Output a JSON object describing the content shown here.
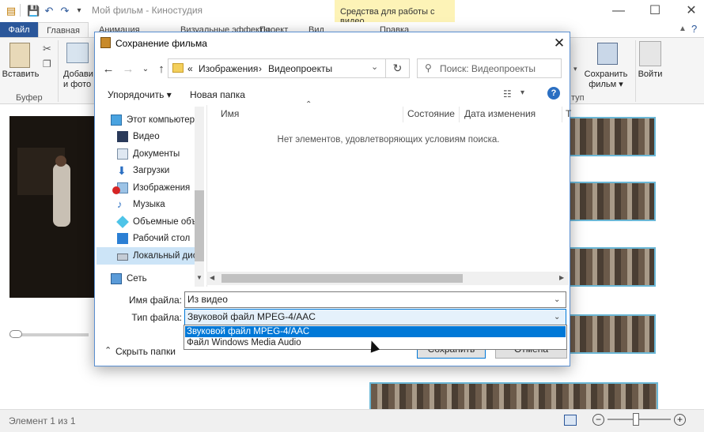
{
  "window": {
    "title": "Мой фильм - Киностудия",
    "tools_tab": "Средства для работы с видео",
    "tools_subtab": "Правка"
  },
  "tabs": [
    "Файл",
    "Главная",
    "Анимация",
    "Визуальные эффекты",
    "Проект",
    "Вид"
  ],
  "ribbon": {
    "paste": "Вставить",
    "buffer_group": "Буфер",
    "add_video_line1": "Добави",
    "add_video_line2": "и фото",
    "save_movie_line1": "Сохранить",
    "save_movie_line2": "фильм ▾",
    "signin": "Войти",
    "access_group": "туп"
  },
  "dialog": {
    "title": "Сохранение фильма",
    "breadcrumb": {
      "prefix": "«",
      "part1": "Изображения",
      "sep": "›",
      "part2": "Видеопроекты"
    },
    "search_placeholder": "Поиск: Видеопроекты",
    "organize": "Упорядочить ▾",
    "new_folder": "Новая папка",
    "nav_items": [
      {
        "label": "Этот компьютер",
        "icon": "computer-icon"
      },
      {
        "label": "Видео",
        "icon": "video-folder-icon"
      },
      {
        "label": "Документы",
        "icon": "documents-folder-icon"
      },
      {
        "label": "Загрузки",
        "icon": "downloads-folder-icon"
      },
      {
        "label": "Изображения",
        "icon": "pictures-folder-icon"
      },
      {
        "label": "Музыка",
        "icon": "music-folder-icon"
      },
      {
        "label": "Объемные объ",
        "icon": "3d-objects-folder-icon"
      },
      {
        "label": "Рабочий стол",
        "icon": "desktop-folder-icon"
      },
      {
        "label": "Локальный дис",
        "icon": "local-disk-icon"
      },
      {
        "label": "Сеть",
        "icon": "network-icon"
      }
    ],
    "columns": [
      "Имя",
      "Состояние",
      "Дата изменения",
      "Т"
    ],
    "empty_message": "Нет элементов, удовлетворяющих условиям поиска.",
    "filename_label": "Имя файла:",
    "filename_value": "Из видео",
    "filetype_label": "Тип файла:",
    "filetype_value": "Звуковой файл MPEG-4/AAC",
    "filetype_options": [
      "Звуковой файл MPEG-4/AAC",
      "Файл Windows Media Audio"
    ],
    "hide_folders": "Скрыть папки",
    "save_button": "Сохранить",
    "cancel_button": "Отмена"
  },
  "status": {
    "text": "Элемент 1 из 1"
  },
  "colors": {
    "file_tab": "#2b579a",
    "tools_tab": "#fdf3b7",
    "selected_option": "#0078d7",
    "storyboard_border": "#6ab7d6"
  }
}
